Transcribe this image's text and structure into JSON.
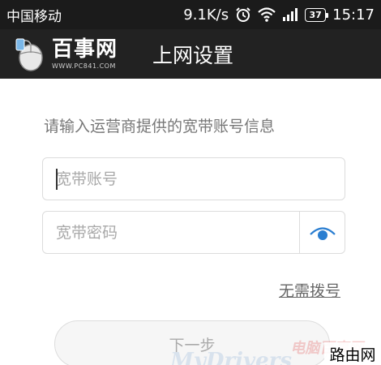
{
  "status_bar": {
    "carrier": "中国移动",
    "network_speed": "9.1K/s",
    "alarm_icon": "alarm-clock-icon",
    "wifi_icon": "wifi-icon",
    "signal_icon": "cell-signal-icon",
    "battery_level": "37",
    "time": "15:17"
  },
  "app_bar": {
    "logo_text": "百事网",
    "logo_url": "WWW.PC841.COM",
    "title": "上网设置",
    "background": "#222222"
  },
  "form": {
    "prompt": "请输入运营商提供的宽带账号信息",
    "account_placeholder": "宽带账号",
    "password_placeholder": "宽带密码",
    "show_password_icon": "eye-icon",
    "accent_color": "#2a7ed1",
    "no_dial_link": "无需拨号",
    "next_button": "下一步"
  },
  "watermarks": {
    "brand": "电脑百事网",
    "italic": "MyDrivers",
    "corner": "路由网"
  }
}
